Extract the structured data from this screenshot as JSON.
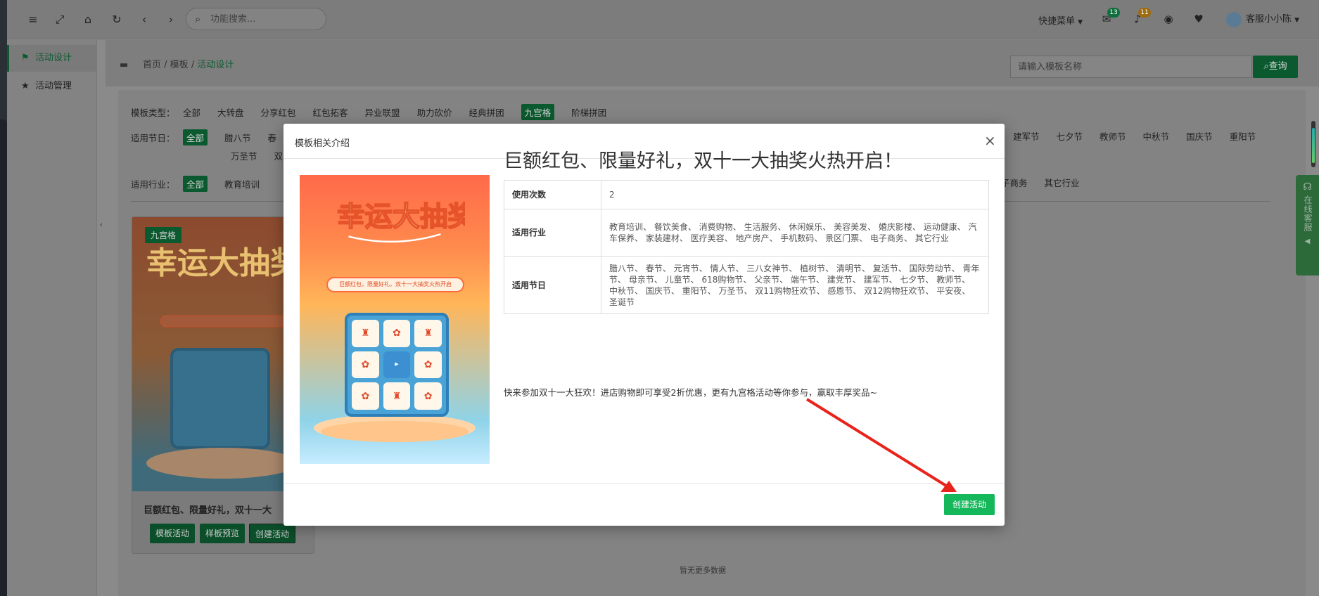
{
  "topbar": {
    "search_placeholder": "功能搜索...",
    "quick_menu": "快捷菜单",
    "mail_count": "13",
    "bell_count": "11",
    "user_name": "客服小小陈"
  },
  "sidebar": {
    "items": [
      {
        "label": "活动设计"
      },
      {
        "label": "活动管理"
      }
    ]
  },
  "breadcrumb": {
    "home": "首页",
    "sep": "/",
    "mid": "模板",
    "current": "活动设计"
  },
  "template_search": {
    "placeholder": "请输入模板名称",
    "button": "查询"
  },
  "filters": {
    "type_label": "模板类型：",
    "types": [
      "全部",
      "大转盘",
      "分享红包",
      "红包拓客",
      "异业联盟",
      "助力砍价",
      "经典拼团",
      "九宫格",
      "阶梯拼团"
    ],
    "holiday_label": "适用节日：",
    "holidays_left": [
      "全部",
      "腊八节",
      "春"
    ],
    "holidays_right": [
      "建军节",
      "七夕节",
      "教师节",
      "中秋节",
      "国庆节",
      "重阳节"
    ],
    "holidays_row2": [
      "万圣节",
      "双"
    ],
    "industry_label": "适用行业：",
    "industries_left": [
      "全部",
      "教育培训"
    ],
    "industries_right": [
      "子商务",
      "其它行业"
    ]
  },
  "card": {
    "tag": "九宫格",
    "title": "巨额红包、限量好礼，双十一大",
    "btn_template": "模板活动",
    "btn_preview": "样板预览",
    "btn_create": "创建活动"
  },
  "no_more": "暂无更多数据",
  "online_cs": "在线客服",
  "modal": {
    "header": "模板相关介绍",
    "close": "×",
    "title": "巨额红包、限量好礼，双十一大抽奖火热开启！",
    "rows": [
      {
        "key": "使用次数",
        "value": "2"
      },
      {
        "key": "适用行业",
        "value": "教育培训、 餐饮美食、 消费购物、 生活服务、 休闲娱乐、 美容美发、 婚庆影楼、 运动健康、 汽车保养、 家装建材、 医疗美容、 地产房产、 手机数码、 景区门票、 电子商务、 其它行业"
      },
      {
        "key": "适用节日",
        "value": "腊八节、 春节、 元宵节、 情人节、 三八女神节、 植树节、 清明节、 复活节、 国际劳动节、 青年节、 母亲节、 儿童节、 618购物节、 父亲节、 端午节、 建党节、 建军节、 七夕节、 教师节、 中秋节、 国庆节、 重阳节、 万圣节、 双11购物狂欢节、 感恩节、 双12购物狂欢节、 平安夜、 圣诞节"
      }
    ],
    "description": "快来参加双十一大狂欢！进店购物即可享受2折优惠，更有九宫格活动等你参与，赢取丰厚奖品~",
    "create_button": "创建活动",
    "poster_banner": "巨额红包，限量好礼，双十一大抽奖火热开启"
  },
  "colors": {
    "accent": "#14b85a",
    "arrow": "#e8231c"
  }
}
